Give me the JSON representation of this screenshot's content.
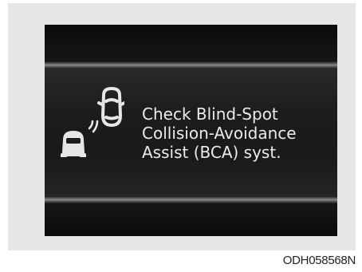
{
  "display": {
    "message_lines": [
      "Check Blind-Spot",
      "Collision-Avoidance",
      "Assist (BCA) syst."
    ],
    "icon": "blind-spot-collision-assist-icon",
    "text_color": "#ebebeb",
    "background_color": "#111111"
  },
  "image_code": "ODH058568N"
}
